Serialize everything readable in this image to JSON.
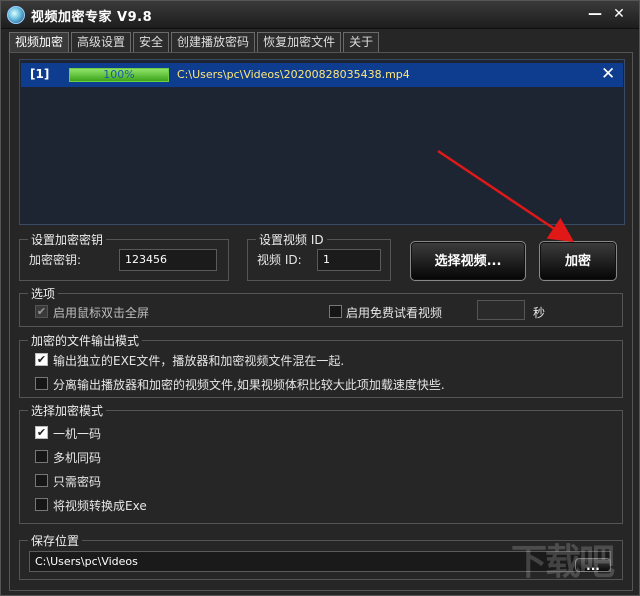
{
  "window": {
    "title": "视频加密专家 V9.8",
    "minimize_glyph": "—",
    "close_glyph": "✕"
  },
  "tabs": [
    {
      "label": "视频加密",
      "active": true
    },
    {
      "label": "高级设置",
      "active": false
    },
    {
      "label": "安全",
      "active": false
    },
    {
      "label": "创建播放密码",
      "active": false
    },
    {
      "label": "恢复加密文件",
      "active": false
    },
    {
      "label": "关于",
      "active": false
    }
  ],
  "file_list": {
    "items": [
      {
        "index": "[1]",
        "progress_text": "100%",
        "progress": 1.0,
        "path": "C:\\Users\\pc\\Videos\\20200828035438.mp4",
        "remove_glyph": "✕"
      }
    ]
  },
  "key_group": {
    "title": "设置加密密钥",
    "label": "加密密钥:",
    "value": "123456"
  },
  "video_id_group": {
    "title": "设置视频 ID",
    "label": "视频 ID:",
    "value": "1"
  },
  "buttons": {
    "select_video": "选择视频...",
    "encrypt": "加密",
    "browse": "..."
  },
  "options_group": {
    "title": "选项",
    "fullscreen_label": "启用鼠标双击全屏",
    "fullscreen_checked": true,
    "trial_label": "启用免费试看视频",
    "trial_checked": false,
    "trial_value": "",
    "seconds_label": "秒"
  },
  "output_group": {
    "title": "加密的文件输出模式",
    "options": [
      {
        "label": "输出独立的EXE文件，播放器和加密视频文件混在一起.",
        "checked": true
      },
      {
        "label": "分离输出播放器和加密的视频文件,如果视频体积比较大此项加载速度快些.",
        "checked": false
      }
    ]
  },
  "mode_group": {
    "title": "选择加密模式",
    "options": [
      {
        "label": "一机一码",
        "checked": true
      },
      {
        "label": "多机同码",
        "checked": false
      },
      {
        "label": "只需密码",
        "checked": false
      },
      {
        "label": "将视频转换成Exe",
        "checked": false
      }
    ]
  },
  "save_group": {
    "title": "保存位置",
    "path": "C:\\Users\\pc\\Videos"
  },
  "colors": {
    "background": "#262626",
    "file_row": "#0e3c8e",
    "progress_green": "#5cc934",
    "path_yellow": "#ffe87a",
    "arrow_red": "#e01818"
  },
  "watermark": "下载吧"
}
